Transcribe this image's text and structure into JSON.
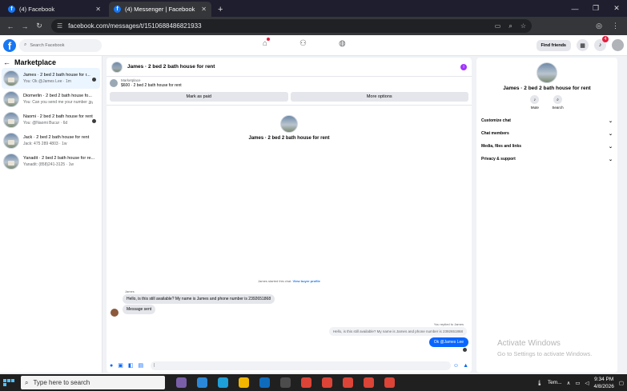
{
  "browser": {
    "tabs": [
      {
        "title": "(4) Facebook",
        "active": false
      },
      {
        "title": "(4) Messenger | Facebook",
        "active": true
      }
    ],
    "new_tab": "+",
    "url": "facebook.com/messages/t/1510688486821933"
  },
  "fbnav": {
    "search_placeholder": "Search Facebook",
    "find_friends": "Find friends",
    "notification_count": "4"
  },
  "sidebar": {
    "title": "Marketplace",
    "conversations": [
      {
        "name": "James · 2 bed 2 bath house for r...",
        "last": "You: Ok @James Lee · 1m",
        "time": ""
      },
      {
        "name": "Diomerlin · 2 bed 2 bath house fo...",
        "last": "You: Can you send me your number ...",
        "time": "2h"
      },
      {
        "name": "Naomi · 2 bed 2 bath house for rent",
        "last": "You: @Naomi Bucur · 6d",
        "time": ""
      },
      {
        "name": "Jack · 2 bed 2 bath house for rent",
        "last": "Jack: 475 289 4803 · 1w",
        "time": ""
      },
      {
        "name": "Yanadit · 2 bed 2 bath house for re...",
        "last": "Yanadit: (858)241-3125 · 1w",
        "time": ""
      }
    ]
  },
  "chat": {
    "title": "James · 2 bed 2 bath house for rent",
    "marketplace_label": "Marketplace",
    "listing": "$600 · 2 bed 2 bath house for rent",
    "mark_as_paid": "Mark as paid",
    "more_options": "More options",
    "intro_title": "James · 2 bed 2 bath house for rent",
    "system_note": "James started this chat.",
    "view_buyer_profile": "View buyer profile",
    "sender": "James",
    "messages_in": [
      "Hello, is this still available? My name is James and phone number is 2392651868",
      "Message sent"
    ],
    "replied_note": "You replied to James",
    "quoted": "Hello, is this still available? My name is James and phone number is 2392651868",
    "message_out": "Ok @James Lee"
  },
  "details": {
    "title": "James · 2 bed 2 bath house for rent",
    "mute": "Mute",
    "search": "Search",
    "sections": [
      "Customize chat",
      "Chat members",
      "Media, files and links",
      "Privacy & support"
    ]
  },
  "watermark": {
    "line1": "Activate Windows",
    "line2": "Go to Settings to activate Windows."
  },
  "taskbar": {
    "search_placeholder": "Type here to search",
    "weather": "Tem...",
    "time": "9:34 PM",
    "date": "4/8/2026"
  },
  "colors": {
    "accent": "#0866ff",
    "brand": "#1877f2",
    "badge": "#e41e3f"
  }
}
